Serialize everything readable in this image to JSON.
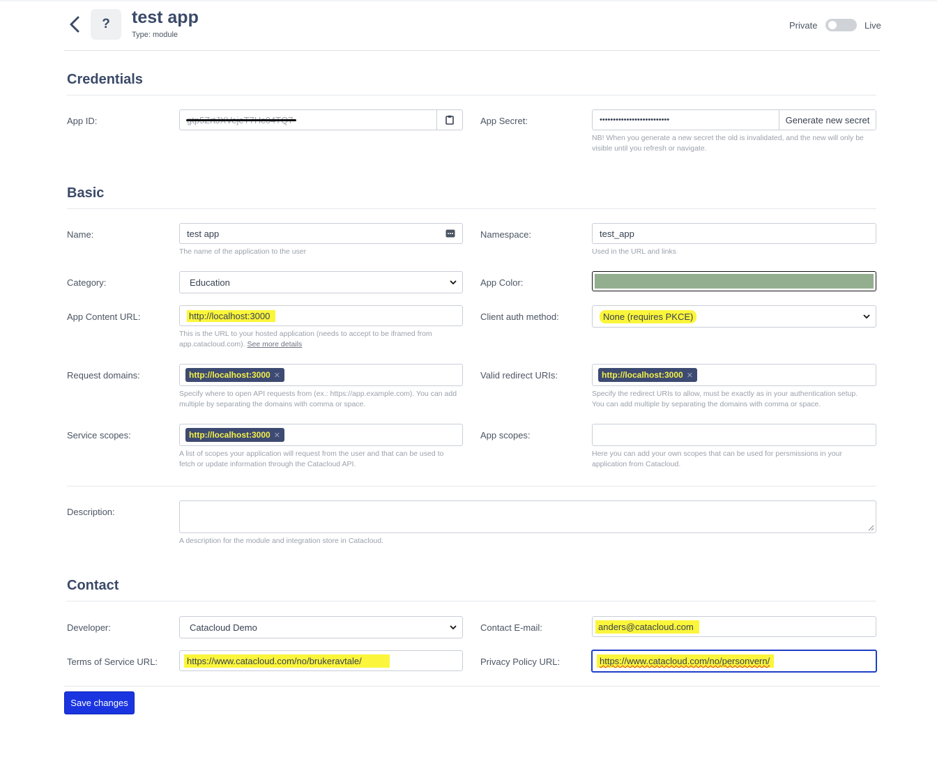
{
  "header": {
    "title": "test app",
    "subtitle": "Type: module",
    "icon_text": "?",
    "toggle_left": "Private",
    "toggle_right": "Live"
  },
  "credentials": {
    "heading": "Credentials",
    "app_id_label": "App ID:",
    "app_id_value": "gtp5ZrtJXVejeT7Hc04TQ7",
    "app_secret_label": "App Secret:",
    "app_secret_value": "••••••••••••••••••••••••••",
    "generate_label": "Generate new secret",
    "secret_help": "NB! When you generate a new secret the old is invalidated, and the new will only be visible until you refresh or navigate."
  },
  "basic": {
    "heading": "Basic",
    "name_label": "Name:",
    "name_value": "test app",
    "name_help": "The name of the application to the user",
    "namespace_label": "Namespace:",
    "namespace_value": "test_app",
    "namespace_help": "Used in the URL and links",
    "category_label": "Category:",
    "category_value": "Education",
    "app_color_label": "App Color:",
    "app_color_value": "#93ae8e",
    "content_url_label": "App Content URL:",
    "content_url_value": "http://localhost:3000",
    "content_url_help": "This is the URL to your hosted application (needs to accept to be iframed from app.catacloud.com).",
    "content_url_link": "See more details",
    "auth_method_label": "Client auth method:",
    "auth_method_value": "None (requires PKCE)",
    "request_domains_label": "Request domains:",
    "request_domains_chip": "http://localhost:3000",
    "request_domains_help": "Specify where to open API requests from (ex.: https://app.example.com). You can add multiple by separating the domains with comma or space.",
    "redirect_label": "Valid redirect URIs:",
    "redirect_chip": "http://localhost:3000",
    "redirect_help": "Specify the redirect URIs to allow, must be exactly as in your authentication setup. You can add multiple by separating the domains with comma or space.",
    "service_scopes_label": "Service scopes:",
    "service_scopes_chip": "http://localhost:3000",
    "service_scopes_help": "A list of scopes your application will request from the user and that can be used to fetch or update information through the Catacloud API.",
    "app_scopes_label": "App scopes:",
    "app_scopes_help": "Here you can add your own scopes that can be used for persmissions in your application from Catacloud.",
    "description_label": "Description:",
    "description_help": "A description for the module and integration store in Catacloud."
  },
  "contact": {
    "heading": "Contact",
    "developer_label": "Developer:",
    "developer_value": "Catacloud Demo",
    "email_label": "Contact E-mail:",
    "email_value": "anders@catacloud.com",
    "tos_label": "Terms of Service URL:",
    "tos_value": "https://www.catacloud.com/no/brukeravtale/",
    "privacy_label": "Privacy Policy URL:",
    "privacy_value": "https://www.catacloud.com/no/personvern/"
  },
  "actions": {
    "save_label": "Save changes"
  },
  "colors": {
    "primary": "#1a35e0",
    "heading": "#3b4a68",
    "highlight": "#fbf53b",
    "chip_bg": "#3d4a72"
  }
}
